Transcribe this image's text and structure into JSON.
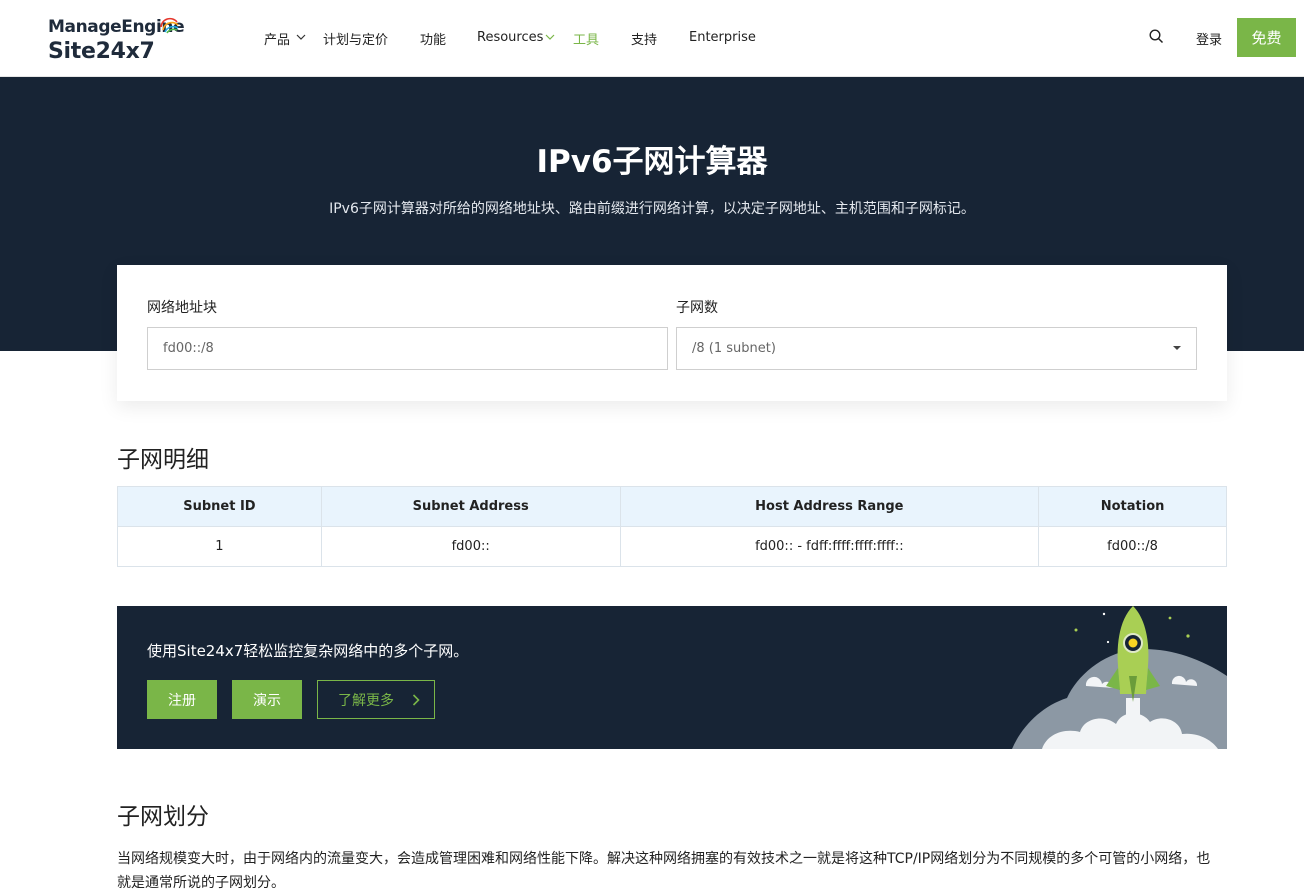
{
  "header": {
    "logo_top": "ManageEngine",
    "logo_bottom": "Site24x7",
    "nav": {
      "products": "产品",
      "pricing": "计划与定价",
      "features": "功能",
      "resources": "Resources",
      "tools": "工具",
      "support": "支持",
      "enterprise": "Enterprise"
    },
    "login": "登录",
    "free": "免费"
  },
  "hero": {
    "title": "IPv6子网计算器",
    "subtitle": "IPv6子网计算器对所给的网络地址块、路由前缀进行网络计算，以决定子网地址、主机范围和子网标记。"
  },
  "form": {
    "network_label": "网络地址块",
    "network_value": "fd00::/8",
    "subnets_label": "子网数",
    "subnets_value": "/8 (1 subnet)"
  },
  "details": {
    "title": "子网明细",
    "columns": [
      "Subnet ID",
      "Subnet Address",
      "Host Address Range",
      "Notation"
    ],
    "rows": [
      [
        "1",
        "fd00::",
        "fd00:: - fdff:ffff:ffff:ffff::",
        "fd00::/8"
      ]
    ]
  },
  "promo": {
    "text": "使用Site24x7轻松监控复杂网络中的多个子网。",
    "signup": "注册",
    "demo": "演示",
    "learn_more": "了解更多"
  },
  "subnetting": {
    "title": "子网划分",
    "text": "当网络规模变大时，由于网络内的流量变大，会造成管理困难和网络性能下降。解决这种网络拥塞的有效技术之一就是将这种TCP/IP网络划分为不同规模的多个可管的小网络，也就是通常所说的子网划分。"
  },
  "colors": {
    "accent": "#7ab648",
    "dark": "#172435"
  }
}
